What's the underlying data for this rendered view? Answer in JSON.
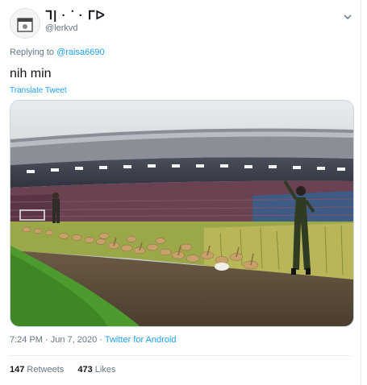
{
  "author": {
    "display_name": "ᒣ| · ᐝ · ᒥᐅ",
    "handle": "@lerkvd"
  },
  "reply": {
    "prefix": "Replying to",
    "to_handle": "@raisa6690"
  },
  "tweet": {
    "text": "nih min",
    "translate_label": "Translate Tweet"
  },
  "meta": {
    "time": "7:24 PM",
    "date": "Jun 7, 2020",
    "separator": "·",
    "source": "Twitter for Android"
  },
  "stats": {
    "retweets_count": "147",
    "retweets_label": "Retweets",
    "likes_count": "473",
    "likes_label": "Likes"
  },
  "colors": {
    "link": "#1da1f2",
    "secondary": "#657786"
  }
}
